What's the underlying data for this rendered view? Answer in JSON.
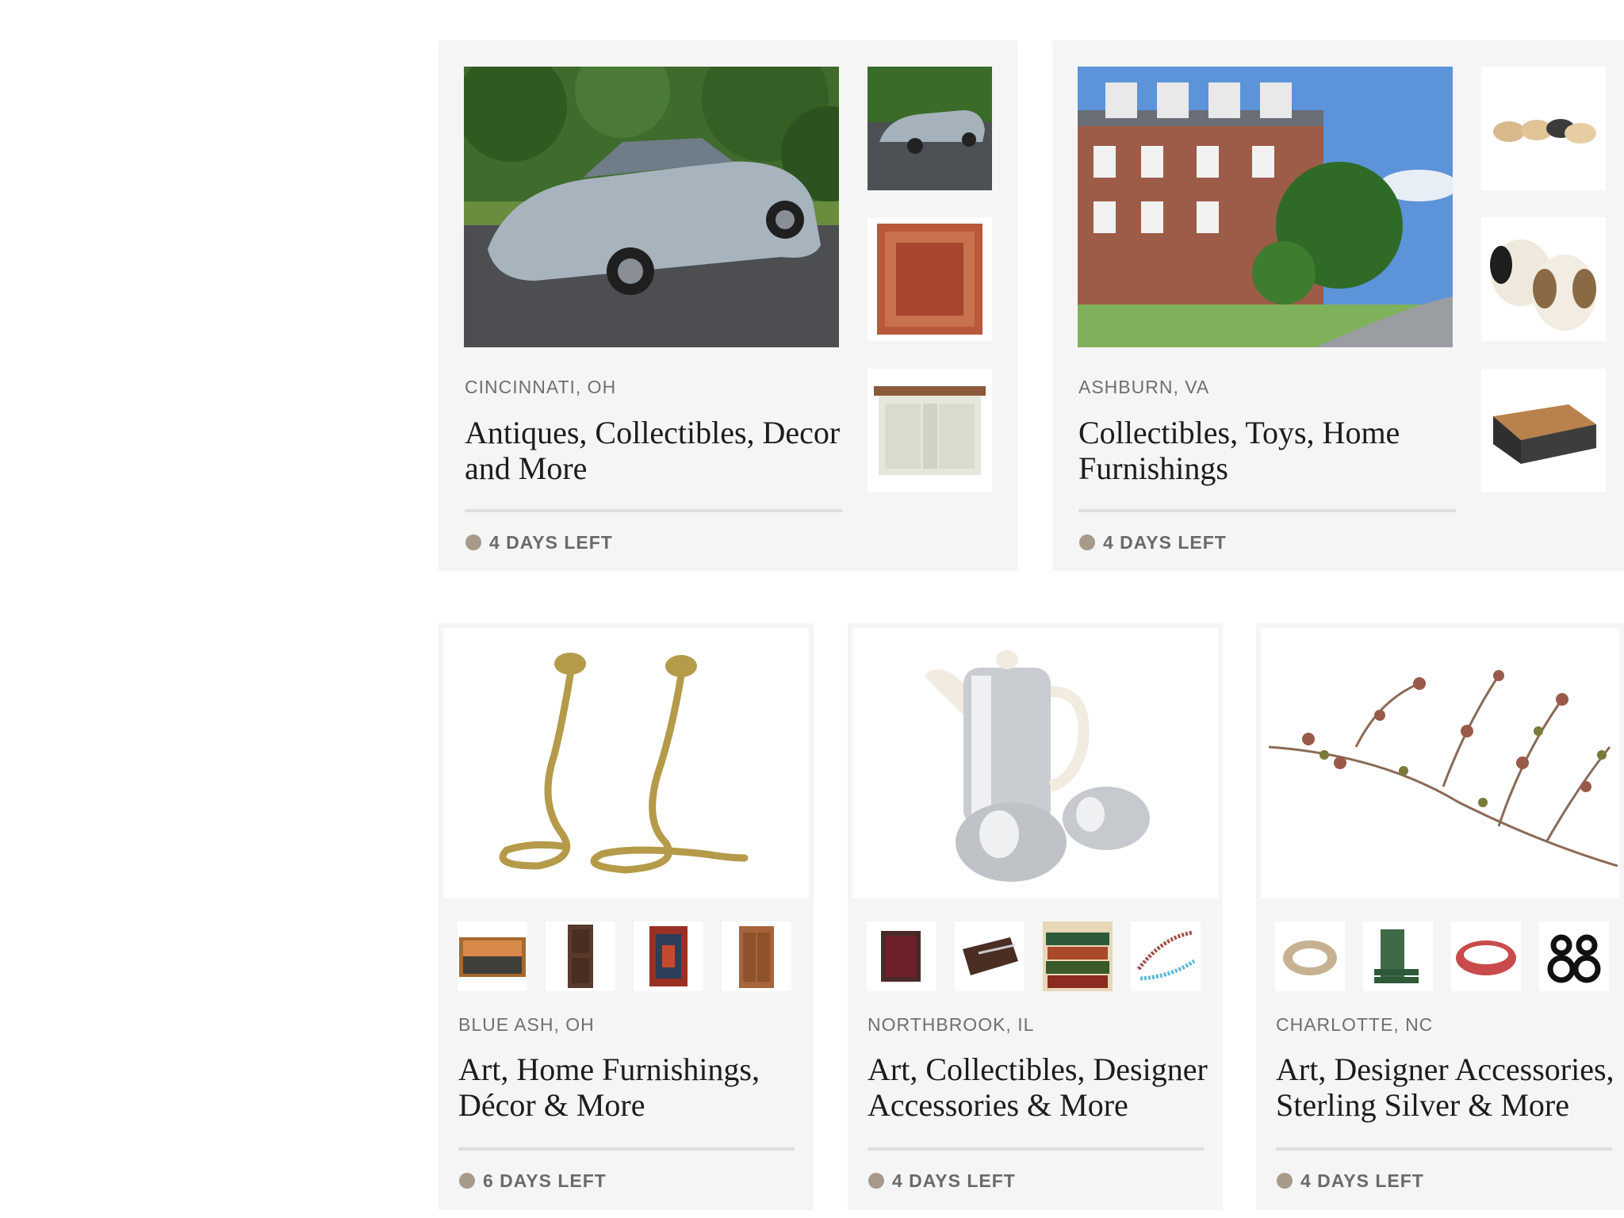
{
  "auctions": [
    {
      "location": "CINCINNATI, OH",
      "title": "Antiques, Collectibles, Decor and More",
      "status": "4 DAYS LEFT"
    },
    {
      "location": "ASHBURN, VA",
      "title": "Collectibles, Toys, Home Furnishings",
      "status": "4 DAYS LEFT"
    },
    {
      "location": "BLUE ASH, OH",
      "title": "Art, Home Furnishings, Décor & More",
      "status": "6 DAYS LEFT"
    },
    {
      "location": "NORTHBROOK, IL",
      "title": "Art, Collectibles, Designer Accessories & More",
      "status": "4 DAYS LEFT"
    },
    {
      "location": "CHARLOTTE, NC",
      "title": "Art, Designer Accessories, Sterling Silver & More",
      "status": "4 DAYS LEFT"
    }
  ],
  "colors": {
    "card_bg": "#f5f5f5",
    "status_dot": "#a89a8a",
    "divider": "#dedede"
  }
}
